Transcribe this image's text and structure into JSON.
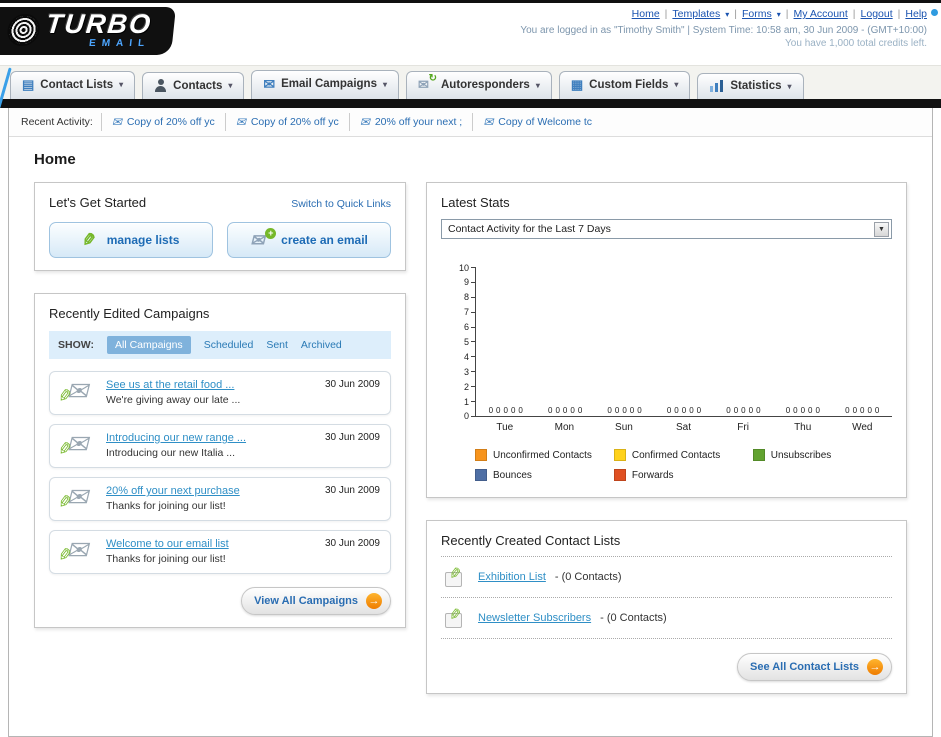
{
  "ui": {
    "caret": "▾",
    "separator": "|",
    "select_arrow": "▼",
    "button_arrow": "→"
  },
  "header": {
    "logo_line1": "TURBO",
    "logo_line2": "EMAIL",
    "nav": [
      {
        "label": "Home"
      },
      {
        "label": "Templates"
      },
      {
        "label": "Forms"
      },
      {
        "label": "My Account"
      },
      {
        "label": "Logout"
      },
      {
        "label": "Help"
      }
    ],
    "login_info": "You are logged in as \"Timothy Smith\" | System Time: 10:58 am, 30 Jun 2009 - (GMT+10:00)",
    "credits_info": "You have 1,000 total credits left."
  },
  "main_nav": {
    "tabs": [
      {
        "label": "Contact Lists",
        "icon": "contact-lists-icon"
      },
      {
        "label": "Contacts",
        "icon": "contacts-icon"
      },
      {
        "label": "Email Campaigns",
        "icon": "email-campaigns-icon"
      },
      {
        "label": "Autoresponders",
        "icon": "autoresponders-icon"
      },
      {
        "label": "Custom Fields",
        "icon": "custom-fields-icon"
      },
      {
        "label": "Statistics",
        "icon": "statistics-icon"
      }
    ]
  },
  "recent_activity": {
    "label": "Recent Activity:",
    "items": [
      "Copy of 20% off yc",
      "Copy of 20% off yc",
      "20% off your next ;",
      "Copy of Welcome tc"
    ]
  },
  "page": {
    "title": "Home"
  },
  "get_started": {
    "title": "Let's Get Started",
    "switch_link": "Switch to Quick Links",
    "manage_lists_label": "manage lists",
    "create_email_label": "create an email"
  },
  "campaigns": {
    "title": "Recently Edited Campaigns",
    "show_label": "SHOW:",
    "filters": [
      "All Campaigns",
      "Scheduled",
      "Sent",
      "Archived"
    ],
    "active_filter": "All Campaigns",
    "items": [
      {
        "title": "See us at the retail food ...",
        "subtitle": "We're giving away our late ...",
        "date": "30 Jun 2009"
      },
      {
        "title": "Introducing our new range ...",
        "subtitle": "Introducing our new Italia ...",
        "date": "30 Jun 2009"
      },
      {
        "title": "20% off your next purchase",
        "subtitle": "Thanks for joining our list!",
        "date": "30 Jun 2009"
      },
      {
        "title": "Welcome to our email list",
        "subtitle": "Thanks for joining our list!",
        "date": "30 Jun 2009"
      }
    ],
    "view_all_label": "View All Campaigns"
  },
  "stats": {
    "title": "Latest Stats",
    "dropdown_value": "Contact Activity for the Last 7 Days",
    "chart_data": {
      "type": "bar",
      "categories": [
        "Tue",
        "Mon",
        "Sun",
        "Sat",
        "Fri",
        "Thu",
        "Wed"
      ],
      "series": [
        {
          "name": "Unconfirmed Contacts",
          "color": "#f7941d",
          "values": [
            0,
            0,
            0,
            0,
            0,
            0,
            0
          ]
        },
        {
          "name": "Confirmed Contacts",
          "color": "#ffd21c",
          "values": [
            0,
            0,
            0,
            0,
            0,
            0,
            0
          ]
        },
        {
          "name": "Unsubscribes",
          "color": "#62a330",
          "values": [
            0,
            0,
            0,
            0,
            0,
            0,
            0
          ]
        },
        {
          "name": "Bounces",
          "color": "#4f6fa5",
          "values": [
            0,
            0,
            0,
            0,
            0,
            0,
            0
          ]
        },
        {
          "name": "Forwards",
          "color": "#e05022",
          "values": [
            0,
            0,
            0,
            0,
            0,
            0,
            0
          ]
        }
      ],
      "ylim": [
        0,
        10
      ],
      "ytick_step": 1,
      "grid": false,
      "legend_position": "bottom"
    }
  },
  "contact_lists": {
    "title": "Recently Created Contact Lists",
    "items": [
      {
        "name": "Exhibition List",
        "detail": "- (0 Contacts)"
      },
      {
        "name": "Newsletter Subscribers",
        "detail": "- (0 Contacts)"
      }
    ],
    "see_all_label": "See All Contact Lists"
  }
}
